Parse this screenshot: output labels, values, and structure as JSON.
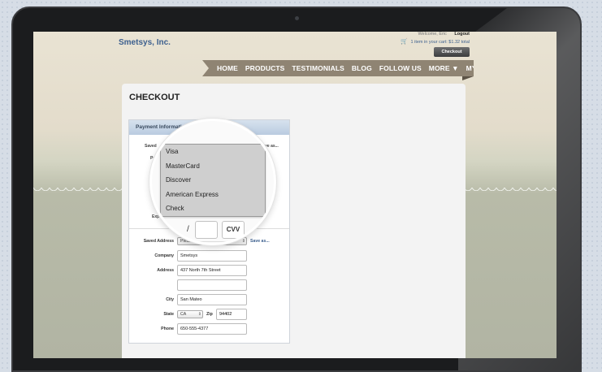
{
  "site": {
    "logo": "Smetsys, Inc.",
    "welcome_text": "Welcome, Eric",
    "logout_label": "Logout",
    "cart_text": "1 item in your cart: $1.32 total",
    "checkout_button": "Checkout"
  },
  "nav": {
    "items": [
      {
        "label": "HOME"
      },
      {
        "label": "PRODUCTS"
      },
      {
        "label": "TESTIMONIALS"
      },
      {
        "label": "BLOG"
      },
      {
        "label": "FOLLOW US"
      },
      {
        "label": "MORE ▼"
      },
      {
        "label": "MY ACCOUNT"
      }
    ]
  },
  "page": {
    "title": "CHECKOUT"
  },
  "payment": {
    "section_title": "Payment Information",
    "saved_payment_label": "Saved",
    "saved_payment_save_as": "Save as...",
    "payment_label": "Payment",
    "expiration_label": "Expir",
    "current_value_fragment": "isa",
    "card_options": [
      "Visa",
      "MasterCard",
      "Discover",
      "American Express",
      "Check"
    ],
    "expiration_separator": "/",
    "cvv_label": "CVV"
  },
  "address": {
    "saved_address_label": "Saved Address",
    "saved_address_placeholder": "Please choose",
    "save_as_label": "Save as...",
    "company_label": "Company",
    "company_value": "Smetsys",
    "address_label": "Address",
    "address_line1": "437 North 7th Street",
    "address_line2": "",
    "city_label": "City",
    "city_value": "San Mateo",
    "state_label": "State",
    "state_value": "CA",
    "zip_label": "Zip",
    "zip_value": "94402",
    "phone_label": "Phone",
    "phone_value": "650-555-4377"
  },
  "colors": {
    "accent_blue": "#3c5f8e",
    "nav_bg": "#8f8473",
    "form_header": "#c7d6e8"
  }
}
